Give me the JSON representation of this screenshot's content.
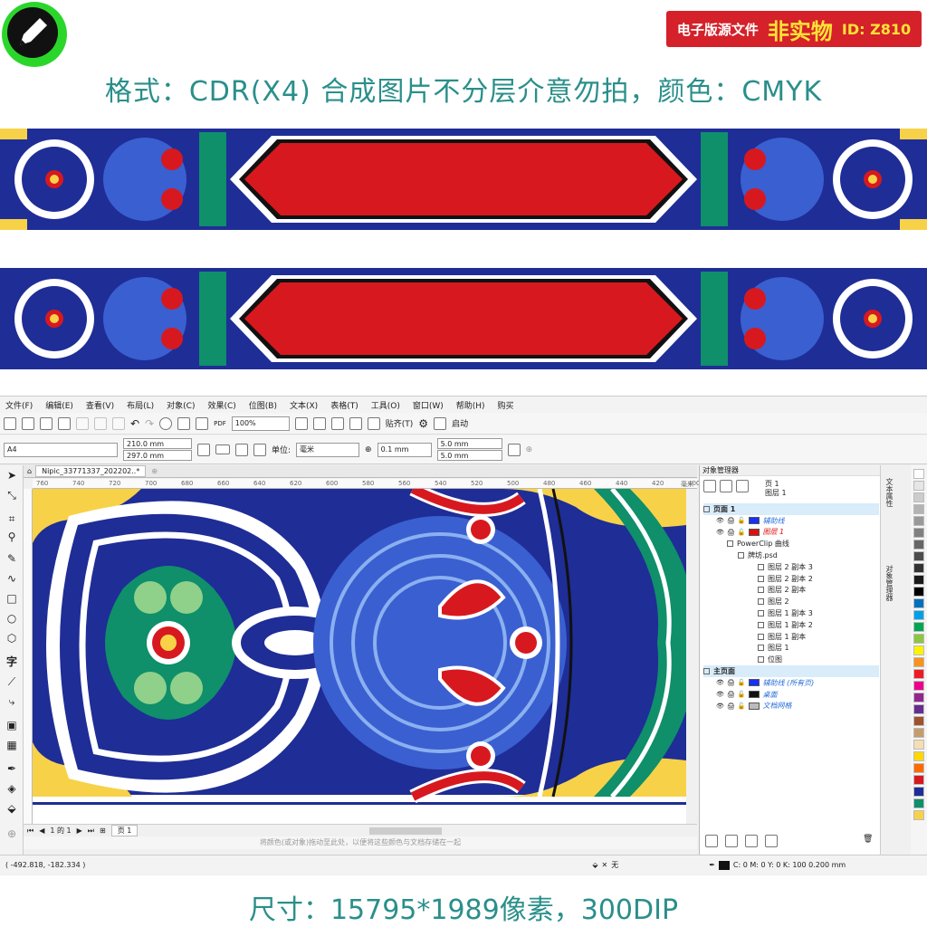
{
  "header": {
    "badge_label": "电子版源文件",
    "badge_highlight": "非实物",
    "badge_id": "ID: Z810",
    "format_line": "格式：CDR(X4) 合成图片不分层介意勿拍，颜色：CMYK",
    "size_line": "尺寸：15795*1989像素，300DIP"
  },
  "colors": {
    "accent_teal": "#2a8f8a",
    "badge_red": "#d4212a",
    "navy": "#1f2d96",
    "red": "#d7191f",
    "green": "#0f8f6a",
    "yellow": "#f7d248"
  },
  "menu": [
    "文件(F)",
    "编辑(E)",
    "查看(V)",
    "布局(L)",
    "对象(C)",
    "效果(C)",
    "位图(B)",
    "文本(X)",
    "表格(T)",
    "工具(O)",
    "窗口(W)",
    "帮助(H)",
    "购买"
  ],
  "toolbar1": {
    "zoom_value": "100%",
    "snap_label": "贴齐(T)",
    "launch_label": "启动"
  },
  "toolbar2": {
    "page_size": "A4",
    "width": "210.0 mm",
    "height": "297.0 mm",
    "units_label": "单位:",
    "units_value": "毫米",
    "nudge": "0.1 mm",
    "dup_x": "5.0 mm",
    "dup_y": "5.0 mm"
  },
  "document": {
    "tab_title": "Nipic_33771337_202202..*",
    "ruler_ticks": [
      "760",
      "740",
      "720",
      "700",
      "680",
      "660",
      "640",
      "620",
      "600",
      "580",
      "560",
      "540",
      "520",
      "500",
      "480",
      "460",
      "440",
      "420",
      "400"
    ],
    "ruler_unit": "毫米"
  },
  "pagebar": {
    "page_count": "1 的 1",
    "page_tab": "页 1"
  },
  "hint": "将颜色(或对象)拖动至此处，以便将这些颜色与文档存储在一起",
  "status": {
    "coords": "( -492.818, -182.334 )",
    "fill_none": "无",
    "outline": "C: 0 M: 0 Y: 0 K: 100  0.200 mm"
  },
  "object_manager": {
    "title": "对象管理器",
    "page_label": "页 1",
    "layer_label": "图层 1",
    "tree": [
      {
        "label": "页面 1",
        "kind": "page"
      },
      {
        "label": "辅助线",
        "kind": "layer",
        "color": "#1530ff",
        "style": "blue"
      },
      {
        "label": "图层 1",
        "kind": "layer",
        "color": "#e01010",
        "style": "red"
      },
      {
        "label": "PowerClip 曲线",
        "kind": "obj"
      },
      {
        "label": "牌坊.psd",
        "kind": "obj2"
      },
      {
        "label": "图层 2 副本 3",
        "kind": "leaf"
      },
      {
        "label": "图层 2 副本 2",
        "kind": "leaf"
      },
      {
        "label": "图层 2 副本",
        "kind": "leaf"
      },
      {
        "label": "图层 2",
        "kind": "leaf"
      },
      {
        "label": "图层 1 副本 3",
        "kind": "leaf"
      },
      {
        "label": "图层 1 副本 2",
        "kind": "leaf"
      },
      {
        "label": "图层 1 副本",
        "kind": "leaf"
      },
      {
        "label": "图层 1",
        "kind": "leaf"
      },
      {
        "label": "位图",
        "kind": "leaf"
      },
      {
        "label": "主页面",
        "kind": "page"
      },
      {
        "label": "辅助线 (所有页)",
        "kind": "layer",
        "color": "#1530ff",
        "style": "blue"
      },
      {
        "label": "桌面",
        "kind": "layer",
        "color": "#111111",
        "style": "blue"
      },
      {
        "label": "文档网格",
        "kind": "layer",
        "color": "#bbbbbb",
        "style": "blue"
      }
    ]
  },
  "side_tabs": [
    "文本属性",
    "对象管理器"
  ],
  "palette": [
    "#ffffff",
    "#e6e6e6",
    "#cccccc",
    "#b3b3b3",
    "#999999",
    "#808080",
    "#666666",
    "#4d4d4d",
    "#333333",
    "#1a1a1a",
    "#000000",
    "#0072bc",
    "#00a0e9",
    "#00a651",
    "#8dc63f",
    "#fff200",
    "#f7941d",
    "#ed1c24",
    "#ec008c",
    "#92278f",
    "#662d91",
    "#a0522d",
    "#c69c6d",
    "#f5deb3",
    "#ffd700",
    "#ff6a00",
    "#d7191f",
    "#1f2d96",
    "#0f8f6a",
    "#f7d248"
  ]
}
